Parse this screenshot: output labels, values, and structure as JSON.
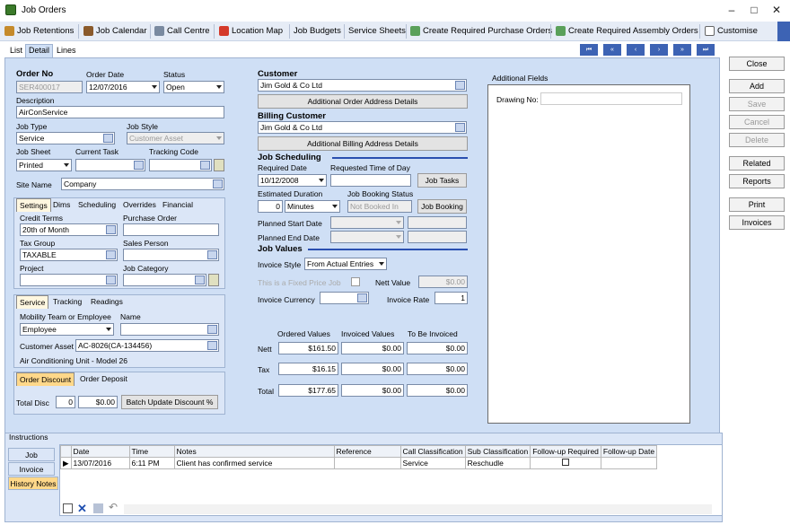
{
  "window": {
    "title": "Job Orders"
  },
  "toolbar": [
    "Job Retentions",
    "Job Calendar",
    "Call Centre",
    "Location Map",
    "Job Budgets",
    "Service Sheets",
    "Create Required Purchase Orders",
    "Create Required Assembly Orders",
    "Customise"
  ],
  "tabs": [
    "List",
    "Detail",
    "Lines"
  ],
  "nav": [
    "⏮",
    "«",
    "‹",
    "›",
    "»",
    "⏭"
  ],
  "order": {
    "no_label": "Order No",
    "no": "SER400017",
    "date_label": "Order Date",
    "date": "12/07/2016",
    "status_label": "Status",
    "status": "Open",
    "desc_label": "Description",
    "desc": "AirConService",
    "jobtype_label": "Job Type",
    "jobtype": "Service",
    "jobstyle_label": "Job Style",
    "jobstyle": "Customer Asset",
    "jobsheet_label": "Job Sheet",
    "jobsheet": "Printed",
    "task_label": "Current Task",
    "tracking_label": "Tracking Code",
    "site_label": "Site Name",
    "site": "Company"
  },
  "settings": {
    "tabs": [
      "Settings",
      "Dims",
      "Scheduling",
      "Overrides",
      "Financial"
    ],
    "credit_label": "Credit Terms",
    "credit": "20th of Month",
    "po_label": "Purchase Order",
    "tax_label": "Tax Group",
    "tax": "TAXABLE",
    "sales_label": "Sales Person",
    "project_label": "Project",
    "category_label": "Job Category"
  },
  "service": {
    "tabs": [
      "Service",
      "Tracking",
      "Readings"
    ],
    "mobility_label": "Mobility Team or Employee",
    "mobility": "Employee",
    "name_label": "Name",
    "asset_label": "Customer Asset",
    "asset": "AC-8026(CA-134456)",
    "asset_desc": "Air Conditioning Unit - Model 26"
  },
  "discount": {
    "tabs": [
      "Order Discount",
      "Order Deposit"
    ],
    "total_label": "Total Disc",
    "pct": "0",
    "amt": "$0.00",
    "batch": "Batch Update Discount %"
  },
  "customer": {
    "label": "Customer",
    "value": "Jim Gold & Co Ltd",
    "addr_btn": "Additional Order Address Details",
    "billing_label": "Billing Customer",
    "billing": "Jim Gold & Co Ltd",
    "billing_btn": "Additional Billing Address Details"
  },
  "sched": {
    "title": "Job Scheduling",
    "req_label": "Required Date",
    "req": "10/12/2008",
    "time_label": "Requested Time of Day",
    "tasks_btn": "Job Tasks",
    "dur_label": "Estimated Duration",
    "dur": "0",
    "dur_unit": "Minutes",
    "status_label": "Job Booking Status",
    "status": "Not Booked In",
    "book_btn": "Job Booking",
    "start_label": "Planned Start Date",
    "end_label": "Planned End Date"
  },
  "values": {
    "title": "Job Values",
    "style_label": "Invoice Style",
    "style": "From Actual Entries",
    "fixed_label": "This is a Fixed Price Job",
    "nett_label": "Nett Value",
    "nett": "$0.00",
    "curr_label": "Invoice Currency",
    "rate_label": "Invoice Rate",
    "rate": "1",
    "cols": [
      "Ordered Values",
      "Invoiced Values",
      "To Be Invoiced"
    ],
    "rows": [
      {
        "label": "Nett",
        "v": [
          "$161.50",
          "$0.00",
          "$0.00"
        ]
      },
      {
        "label": "Tax",
        "v": [
          "$16.15",
          "$0.00",
          "$0.00"
        ]
      },
      {
        "label": "Total",
        "v": [
          "$177.65",
          "$0.00",
          "$0.00"
        ]
      }
    ]
  },
  "additional": {
    "title": "Additional Fields",
    "drawing_label": "Drawing No:"
  },
  "right_buttons": [
    "Close",
    "Add",
    "Save",
    "Cancel",
    "Delete",
    "Related",
    "Reports",
    "Print",
    "Invoices"
  ],
  "instructions": {
    "title": "Instructions",
    "tabs": [
      "Job",
      "Invoice",
      "History Notes"
    ],
    "cols": [
      "Date",
      "Time",
      "Notes",
      "Reference",
      "Call Classification",
      "Sub Classification",
      "Follow-up Required",
      "Follow-up Date"
    ],
    "row": [
      "13/07/2016",
      "6:11 PM",
      "Client has confirmed service",
      "",
      "Service",
      "Reschudle",
      "",
      ""
    ]
  }
}
